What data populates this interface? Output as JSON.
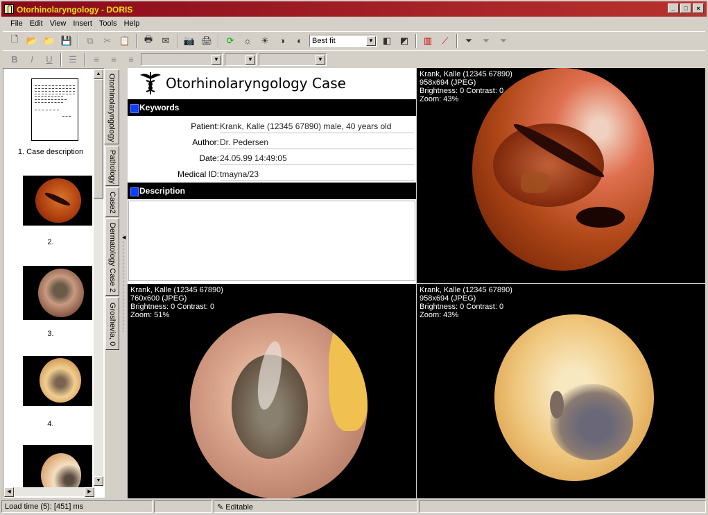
{
  "window": {
    "title": "Otorhinolaryngology - DORIS"
  },
  "menu": [
    "File",
    "Edit",
    "View",
    "Insert",
    "Tools",
    "Help"
  ],
  "toolbar": {
    "zoom_select": "Best fit"
  },
  "thumbnails": [
    {
      "label": "1. Case description"
    },
    {
      "label": "2."
    },
    {
      "label": "3."
    },
    {
      "label": "4."
    }
  ],
  "tabs": [
    "Otorhinolaryngology",
    "Pathology",
    "Case2",
    "Dermatology Case 2",
    "Groshevia, 0"
  ],
  "document": {
    "title": "Otorhinolaryngology Case",
    "keywords_header": "Keywords",
    "description_header": "Description",
    "fields": [
      {
        "label": "Patient:",
        "value": "Krank, Kalle (12345 67890) male, 40 years old"
      },
      {
        "label": "Author:",
        "value": "Dr. Pedersen"
      },
      {
        "label": "Date:",
        "value": "24.05.99 14:49:05"
      },
      {
        "label": "Medical ID:",
        "value": "tmayna/23"
      }
    ]
  },
  "images": [
    {
      "patient": "Krank, Kalle (12345 67890)",
      "size": "958x694 (JPEG)",
      "adjust": "Brightness: 0  Contrast: 0",
      "zoom": "Zoom: 43%"
    },
    {
      "patient": "Krank, Kalle (12345 67890)",
      "size": "760x600 (JPEG)",
      "adjust": "Brightness: 0  Contrast: 0",
      "zoom": "Zoom: 51%"
    },
    {
      "patient": "Krank, Kalle (12345 67890)",
      "size": "958x694 (JPEG)",
      "adjust": "Brightness: 0  Contrast: 0",
      "zoom": "Zoom: 43%"
    }
  ],
  "status": {
    "load_time": "Load time (5): [451] ms",
    "mode": "Editable"
  },
  "colors": {
    "titlebar": "#8a0a1a",
    "title_text": "#f0e000",
    "section_bar": "#000000",
    "section_marker": "#1040ff"
  }
}
